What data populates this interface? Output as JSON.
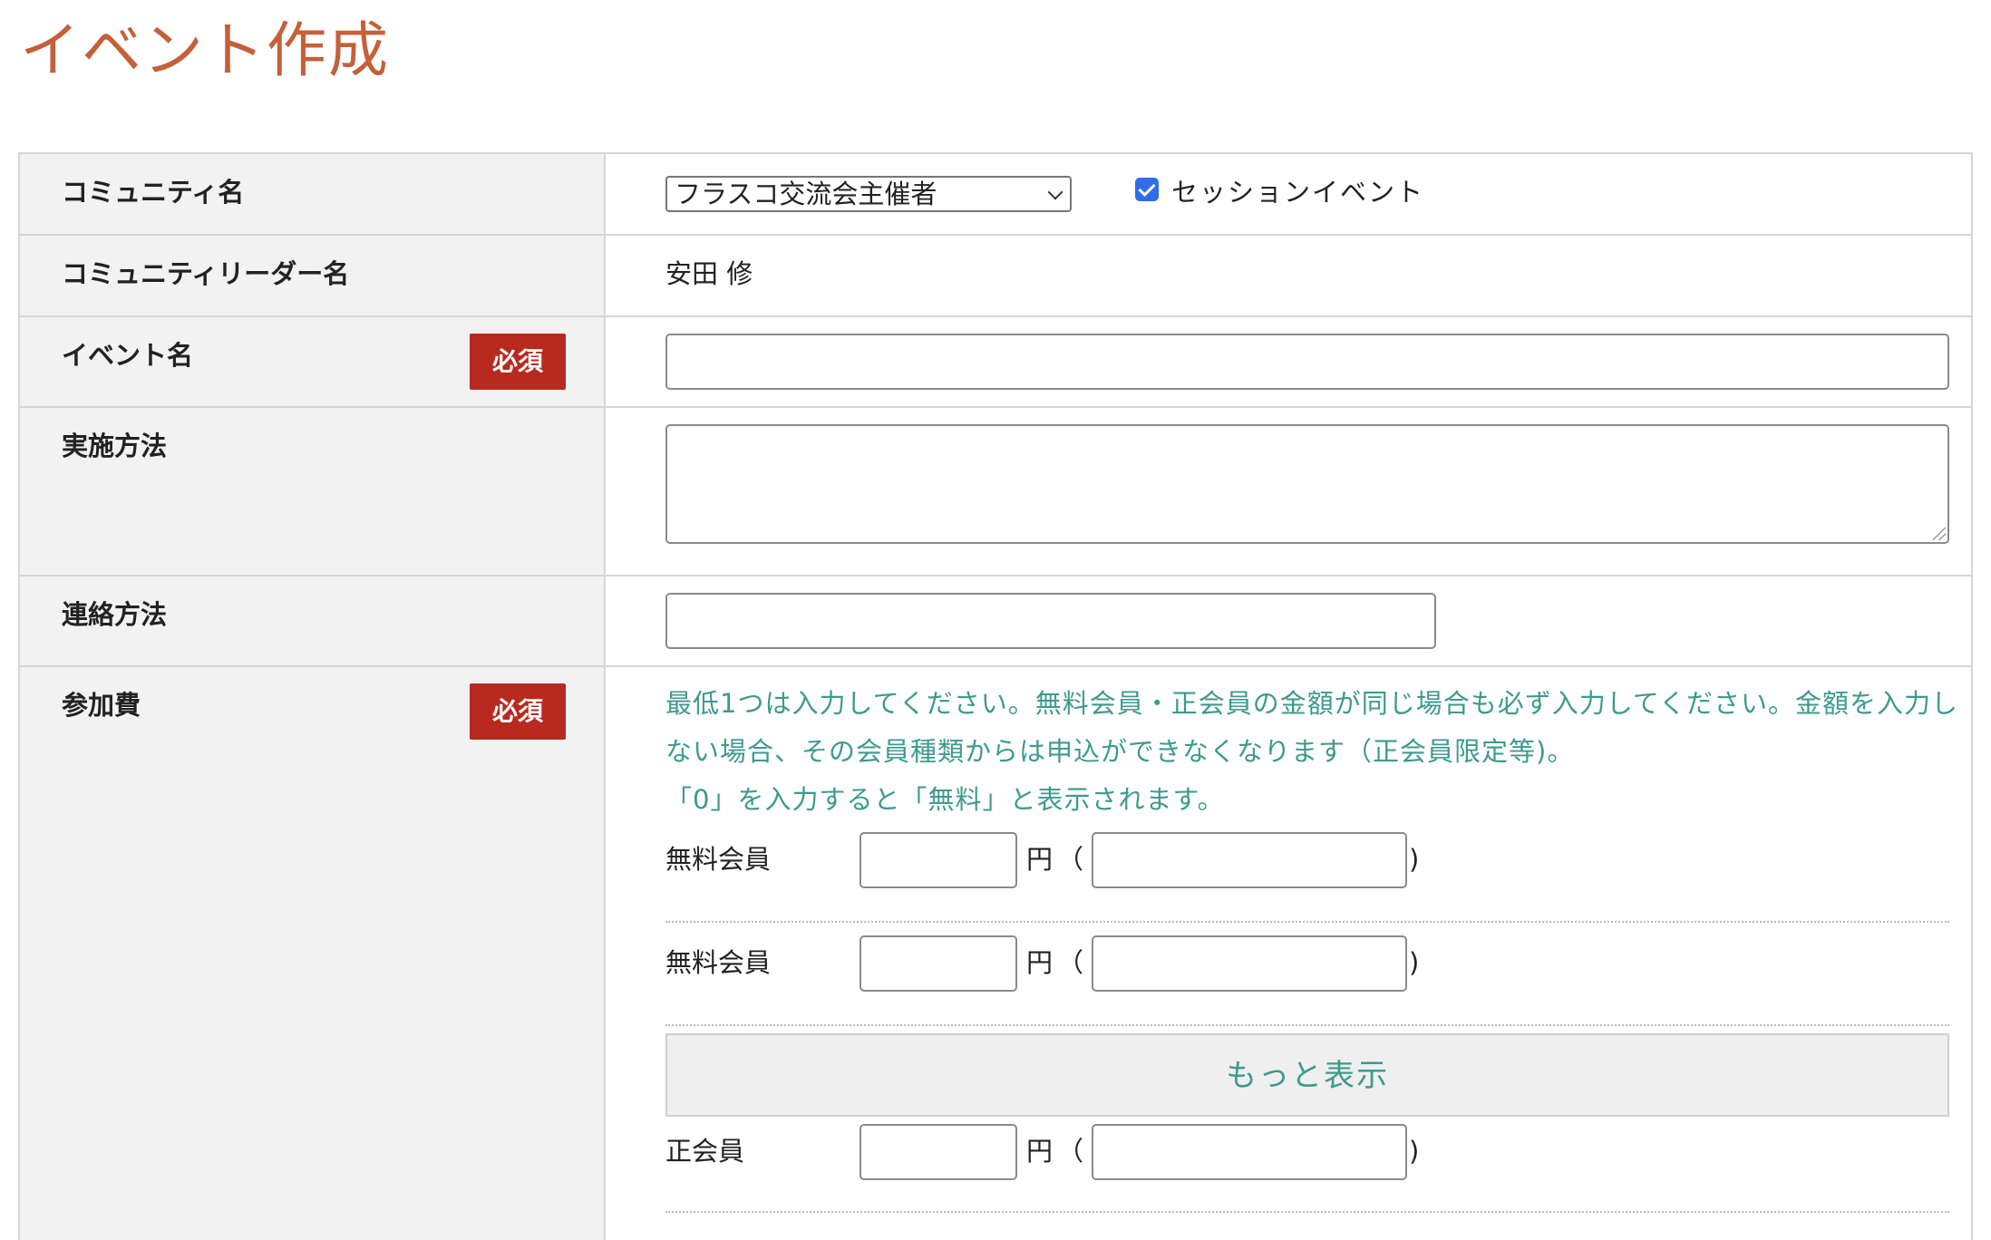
{
  "page": {
    "title": "イベント作成"
  },
  "required_label": "必須",
  "community": {
    "label": "コミュニティ名",
    "selected": "フラスコ交流会主催者",
    "session_checkbox_label": "セッションイベント",
    "session_checked": true
  },
  "leader": {
    "label": "コミュニティリーダー名",
    "value": "安田 修"
  },
  "event_name": {
    "label": "イベント名",
    "value": "",
    "placeholder": ""
  },
  "method": {
    "label": "実施方法",
    "value": "",
    "placeholder": ""
  },
  "contact": {
    "label": "連絡方法",
    "value": "",
    "placeholder": ""
  },
  "fee": {
    "label": "参加費",
    "note_line1": "最低1つは入力してください。無料会員・正会員の金額が同じ場合も必ず入力してください。金額を入力しない場合、その会員種類からは申込ができなくなります（正会員限定等)。",
    "note_line2": "「0」を入力すると「無料」と表示されます。",
    "currency": "円",
    "paren_open": "（",
    "paren_close": ")",
    "rows": [
      {
        "member_type": "無料会員",
        "amount": "",
        "memo": ""
      },
      {
        "member_type": "無料会員",
        "amount": "",
        "memo": ""
      },
      {
        "member_type": "正会員",
        "amount": "",
        "memo": ""
      }
    ],
    "more_button_label": "もっと表示"
  },
  "colors": {
    "title": "#c4603a",
    "required_badge": "#b82a1f",
    "note_text": "#3e9a8e",
    "label_bg": "#f2f2f2",
    "checkbox": "#2f6ee8"
  }
}
